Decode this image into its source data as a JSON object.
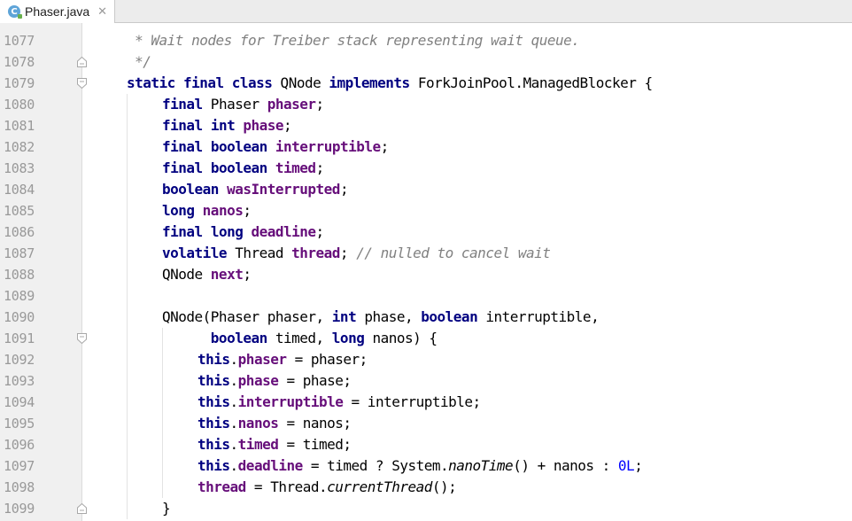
{
  "tab": {
    "icon_letter": "C",
    "file_name": "Phaser.java",
    "close_glyph": "✕"
  },
  "line_numbers": [
    "1077",
    "1078",
    "1079",
    "1080",
    "1081",
    "1082",
    "1083",
    "1084",
    "1085",
    "1086",
    "1087",
    "1088",
    "1089",
    "1090",
    "1091",
    "1092",
    "1093",
    "1094",
    "1095",
    "1096",
    "1097",
    "1098",
    "1099"
  ],
  "fold_markers": {
    "1078": "end",
    "1079": "start",
    "1091": "start",
    "1099": "end"
  },
  "colors": {
    "keyword": "#000080",
    "field": "#660e7a",
    "comment": "#808080",
    "number": "#0000ff",
    "gutter": "#f0f0f0"
  },
  "code_lines": [
    {
      "indent": 1,
      "tokens": [
        {
          "t": " * Wait nodes for Treiber stack representing wait queue.",
          "c": "cm"
        }
      ]
    },
    {
      "indent": 1,
      "tokens": [
        {
          "t": " */",
          "c": "cm"
        }
      ]
    },
    {
      "indent": 1,
      "tokens": [
        {
          "t": "static",
          "c": "kw"
        },
        {
          "t": " "
        },
        {
          "t": "final",
          "c": "kw"
        },
        {
          "t": " "
        },
        {
          "t": "class",
          "c": "kw"
        },
        {
          "t": " QNode "
        },
        {
          "t": "implements",
          "c": "kw"
        },
        {
          "t": " ForkJoinPool.ManagedBlocker {"
        }
      ]
    },
    {
      "indent": 2,
      "tokens": [
        {
          "t": "final",
          "c": "kw"
        },
        {
          "t": " Phaser "
        },
        {
          "t": "phaser",
          "c": "fld"
        },
        {
          "t": ";"
        }
      ]
    },
    {
      "indent": 2,
      "tokens": [
        {
          "t": "final",
          "c": "kw"
        },
        {
          "t": " "
        },
        {
          "t": "int",
          "c": "kw"
        },
        {
          "t": " "
        },
        {
          "t": "phase",
          "c": "fld"
        },
        {
          "t": ";"
        }
      ]
    },
    {
      "indent": 2,
      "tokens": [
        {
          "t": "final",
          "c": "kw"
        },
        {
          "t": " "
        },
        {
          "t": "boolean",
          "c": "kw"
        },
        {
          "t": " "
        },
        {
          "t": "interruptible",
          "c": "fld"
        },
        {
          "t": ";"
        }
      ]
    },
    {
      "indent": 2,
      "tokens": [
        {
          "t": "final",
          "c": "kw"
        },
        {
          "t": " "
        },
        {
          "t": "boolean",
          "c": "kw"
        },
        {
          "t": " "
        },
        {
          "t": "timed",
          "c": "fld"
        },
        {
          "t": ";"
        }
      ]
    },
    {
      "indent": 2,
      "tokens": [
        {
          "t": "boolean",
          "c": "kw"
        },
        {
          "t": " "
        },
        {
          "t": "wasInterrupted",
          "c": "fld"
        },
        {
          "t": ";"
        }
      ]
    },
    {
      "indent": 2,
      "tokens": [
        {
          "t": "long",
          "c": "kw"
        },
        {
          "t": " "
        },
        {
          "t": "nanos",
          "c": "fld"
        },
        {
          "t": ";"
        }
      ]
    },
    {
      "indent": 2,
      "tokens": [
        {
          "t": "final",
          "c": "kw"
        },
        {
          "t": " "
        },
        {
          "t": "long",
          "c": "kw"
        },
        {
          "t": " "
        },
        {
          "t": "deadline",
          "c": "fld"
        },
        {
          "t": ";"
        }
      ]
    },
    {
      "indent": 2,
      "tokens": [
        {
          "t": "volatile",
          "c": "kw"
        },
        {
          "t": " Thread "
        },
        {
          "t": "thread",
          "c": "fld"
        },
        {
          "t": "; "
        },
        {
          "t": "// nulled to cancel wait",
          "c": "cm"
        }
      ]
    },
    {
      "indent": 2,
      "tokens": [
        {
          "t": "QNode "
        },
        {
          "t": "next",
          "c": "fld"
        },
        {
          "t": ";"
        }
      ]
    },
    {
      "indent": 0,
      "tokens": []
    },
    {
      "indent": 2,
      "tokens": [
        {
          "t": "QNode(Phaser phaser, "
        },
        {
          "t": "int",
          "c": "kw"
        },
        {
          "t": " phase, "
        },
        {
          "t": "boolean",
          "c": "kw"
        },
        {
          "t": " interruptible,"
        }
      ]
    },
    {
      "indent": 2,
      "tokens": [
        {
          "t": "      "
        },
        {
          "t": "boolean",
          "c": "kw"
        },
        {
          "t": " timed, "
        },
        {
          "t": "long",
          "c": "kw"
        },
        {
          "t": " nanos) {"
        }
      ]
    },
    {
      "indent": 3,
      "tokens": [
        {
          "t": "this",
          "c": "kw"
        },
        {
          "t": "."
        },
        {
          "t": "phaser",
          "c": "fld"
        },
        {
          "t": " = phaser;"
        }
      ]
    },
    {
      "indent": 3,
      "tokens": [
        {
          "t": "this",
          "c": "kw"
        },
        {
          "t": "."
        },
        {
          "t": "phase",
          "c": "fld"
        },
        {
          "t": " = phase;"
        }
      ]
    },
    {
      "indent": 3,
      "tokens": [
        {
          "t": "this",
          "c": "kw"
        },
        {
          "t": "."
        },
        {
          "t": "interruptible",
          "c": "fld"
        },
        {
          "t": " = interruptible;"
        }
      ]
    },
    {
      "indent": 3,
      "tokens": [
        {
          "t": "this",
          "c": "kw"
        },
        {
          "t": "."
        },
        {
          "t": "nanos",
          "c": "fld"
        },
        {
          "t": " = nanos;"
        }
      ]
    },
    {
      "indent": 3,
      "tokens": [
        {
          "t": "this",
          "c": "kw"
        },
        {
          "t": "."
        },
        {
          "t": "timed",
          "c": "fld"
        },
        {
          "t": " = timed;"
        }
      ]
    },
    {
      "indent": 3,
      "tokens": [
        {
          "t": "this",
          "c": "kw"
        },
        {
          "t": "."
        },
        {
          "t": "deadline",
          "c": "fld"
        },
        {
          "t": " = timed ? System."
        },
        {
          "t": "nanoTime",
          "c": "it"
        },
        {
          "t": "() + nanos : "
        },
        {
          "t": "0L",
          "c": "num"
        },
        {
          "t": ";"
        }
      ]
    },
    {
      "indent": 3,
      "tokens": [
        {
          "t": "thread",
          "c": "fld"
        },
        {
          "t": " = Thread."
        },
        {
          "t": "currentThread",
          "c": "it"
        },
        {
          "t": "();"
        }
      ]
    },
    {
      "indent": 2,
      "tokens": [
        {
          "t": "}"
        }
      ]
    }
  ]
}
